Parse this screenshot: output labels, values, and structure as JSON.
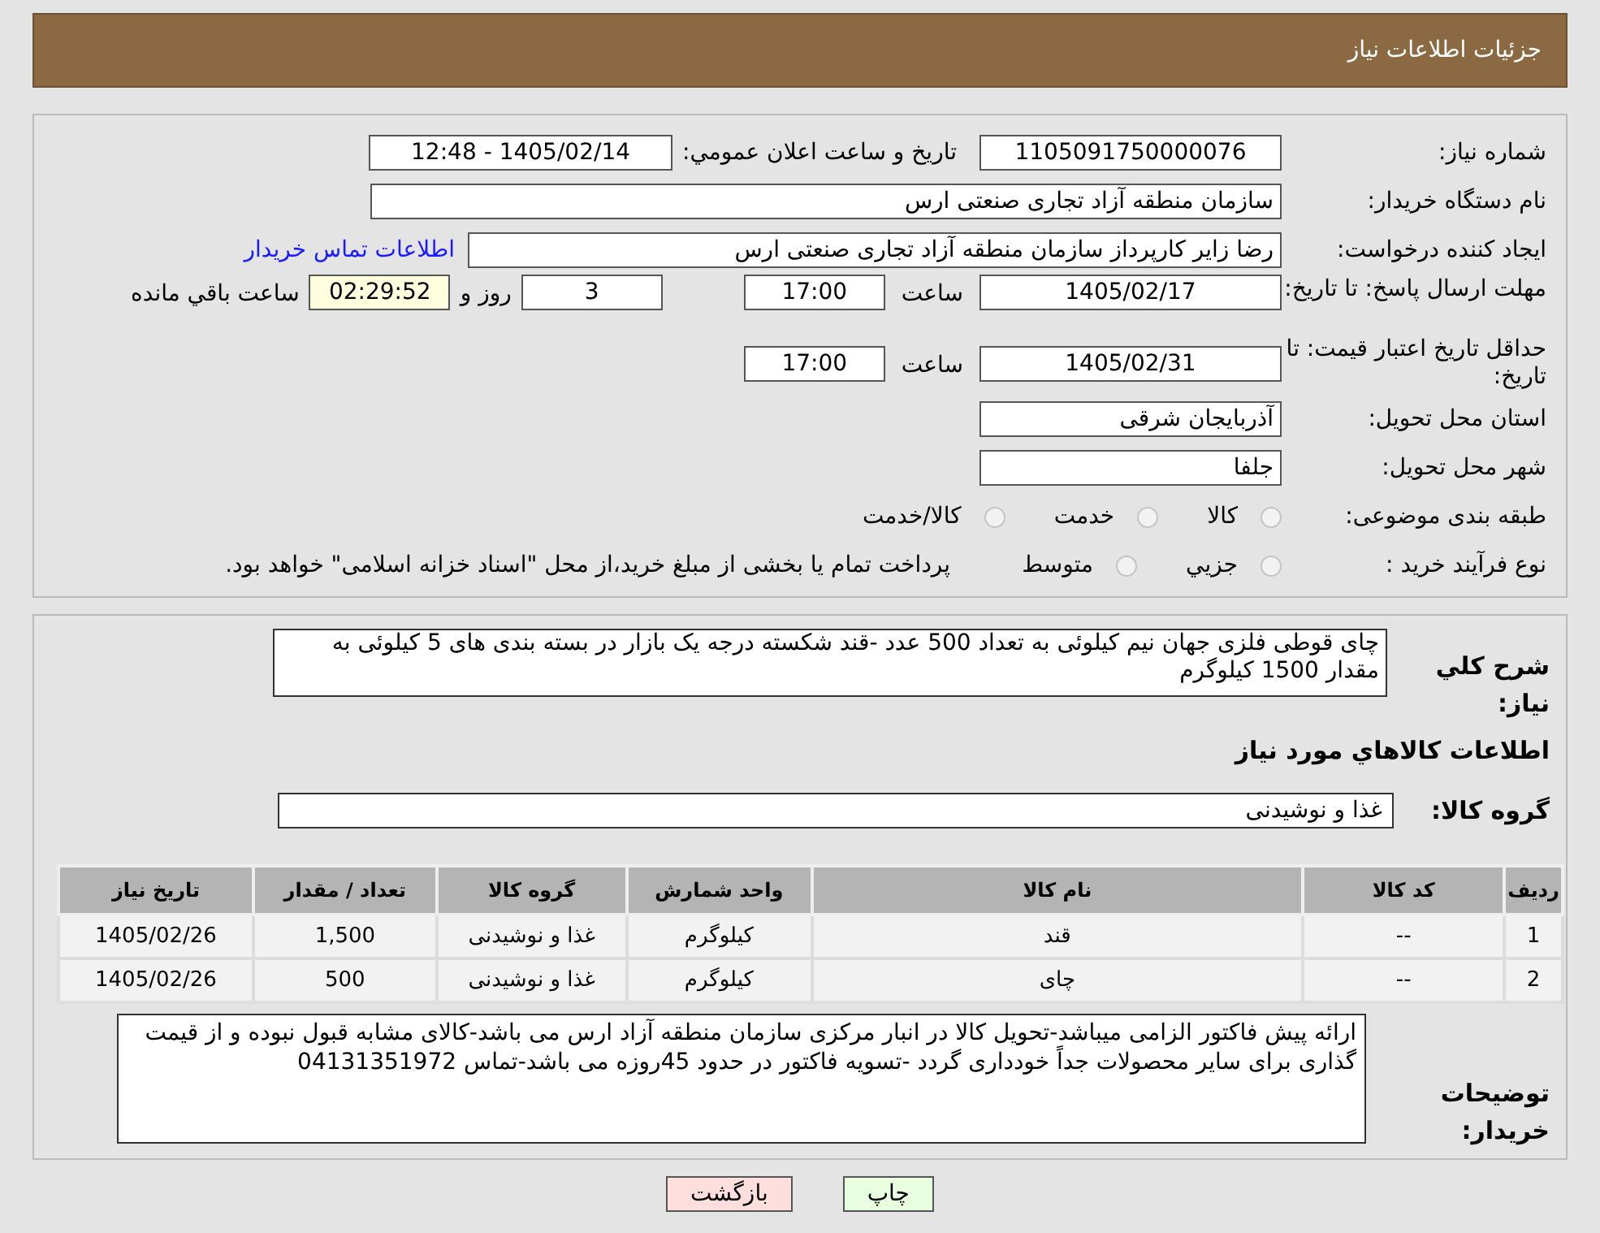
{
  "header": {
    "title": "جزئیات اطلاعات نیاز"
  },
  "need_number": {
    "label": "شماره نیاز:",
    "value": "1105091750000076"
  },
  "announce": {
    "label": "تاریخ و ساعت اعلان عمومي:",
    "value": "1405/02/14 - 12:48"
  },
  "buyer": {
    "label": "نام دستگاه خریدار:",
    "value": "سازمان منطقه آزاد تجاری صنعتی ارس"
  },
  "creator": {
    "label": "ایجاد کننده درخواست:",
    "value": "رضا زایر کارپرداز سازمان منطقه آزاد تجاری صنعتی ارس",
    "link": "اطلاعات تماس خریدار"
  },
  "response_deadline": {
    "label": "مهلت ارسال پاسخ: تا تاریخ:",
    "date": "1405/02/17",
    "time_label": "ساعت",
    "time": "17:00",
    "days": "3",
    "days_label": "روز و",
    "remaining": "02:29:52",
    "remaining_label": "ساعت باقي مانده"
  },
  "price_validity": {
    "label": "حداقل تاریخ اعتبار قیمت: تا تاریخ:",
    "date": "1405/02/31",
    "time_label": "ساعت",
    "time": "17:00"
  },
  "province": {
    "label": "استان محل تحویل:",
    "value": "آذربایجان شرقی"
  },
  "city": {
    "label": "شهر محل تحویل:",
    "value": "جلفا"
  },
  "category": {
    "label": "طبقه بندی موضوعی:",
    "options": [
      {
        "label": "کالا",
        "selected": false
      },
      {
        "label": "خدمت",
        "selected": false
      },
      {
        "label": "کالا/خدمت",
        "selected": false
      }
    ]
  },
  "purchase_process": {
    "label": "نوع فرآیند خرید :",
    "options": [
      {
        "label": "جزیي",
        "selected": false
      },
      {
        "label": "متوسط",
        "selected": false
      }
    ],
    "note": "پرداخت تمام یا بخشی از مبلغ خرید،از محل \"اسناد خزانه اسلامی\" خواهد بود."
  },
  "summary": {
    "label": "شرح کلي نیاز:",
    "value": "چای قوطی فلزی جهان نیم کیلوئی به تعداد 500 عدد -قند شکسته درجه یک بازار در بسته بندی های 5 کیلوئی به مقدار 1500 کیلوگرم"
  },
  "goods_heading": "اطلاعات کالاهاي مورد نیاز",
  "goods_group": {
    "label": "گروه کالا:",
    "value": "غذا و نوشیدنی"
  },
  "table": {
    "columns": [
      "ردیف",
      "کد کالا",
      "نام کالا",
      "واحد شمارش",
      "گروه کالا",
      "تعداد / مقدار",
      "تاریخ نیاز"
    ],
    "rows": [
      [
        "1",
        "--",
        "قند",
        "کیلوگرم",
        "غذا و نوشیدنی",
        "1,500",
        "1405/02/26"
      ],
      [
        "2",
        "--",
        "چای",
        "کیلوگرم",
        "غذا و نوشیدنی",
        "500",
        "1405/02/26"
      ]
    ]
  },
  "buyer_notes": {
    "label": "توضیحات خریدار:",
    "value": "ارائه پیش فاکتور الزامی میباشد-تحویل کالا در انبار مرکزی سازمان منطقه آزاد ارس می باشد-کالای مشابه قبول نبوده و از قیمت گذاری برای سایر محصولات جداً خودداری گردد -تسویه فاکتور در حدود 45روزه می باشد-تماس 04131351972"
  },
  "buttons": [
    {
      "label": "چاپ",
      "kind": "print"
    },
    {
      "label": "بازگشت",
      "kind": "back"
    }
  ]
}
